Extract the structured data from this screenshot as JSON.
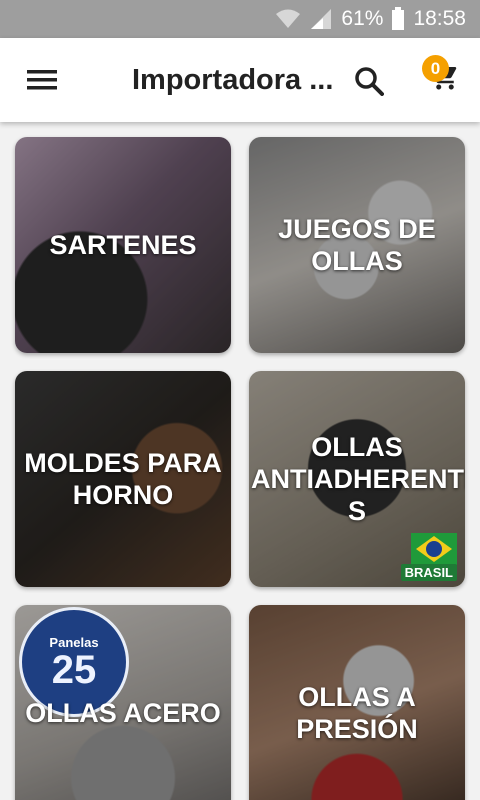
{
  "status_bar": {
    "battery_percent": "61%",
    "time": "18:58"
  },
  "app_bar": {
    "title": "Importadora ...",
    "cart_count": "0"
  },
  "categories": [
    {
      "label": "SARTENES"
    },
    {
      "label": "JUEGOS DE\nOLLAS"
    },
    {
      "label": "MOLDES PARA\nHORNO"
    },
    {
      "label": "OLLAS\nANTIADHERENTE\nS",
      "badge": "BRASIL"
    },
    {
      "label": "OLLAS ACERO",
      "seal": {
        "top": "Panelas",
        "number": "25"
      }
    },
    {
      "label": "OLLAS A\nPRESIÓN"
    }
  ],
  "colors": {
    "status_bar": "#9e9e9e",
    "app_bar": "#ffffff",
    "badge": "#f5a000",
    "background": "#f2f2f2"
  }
}
